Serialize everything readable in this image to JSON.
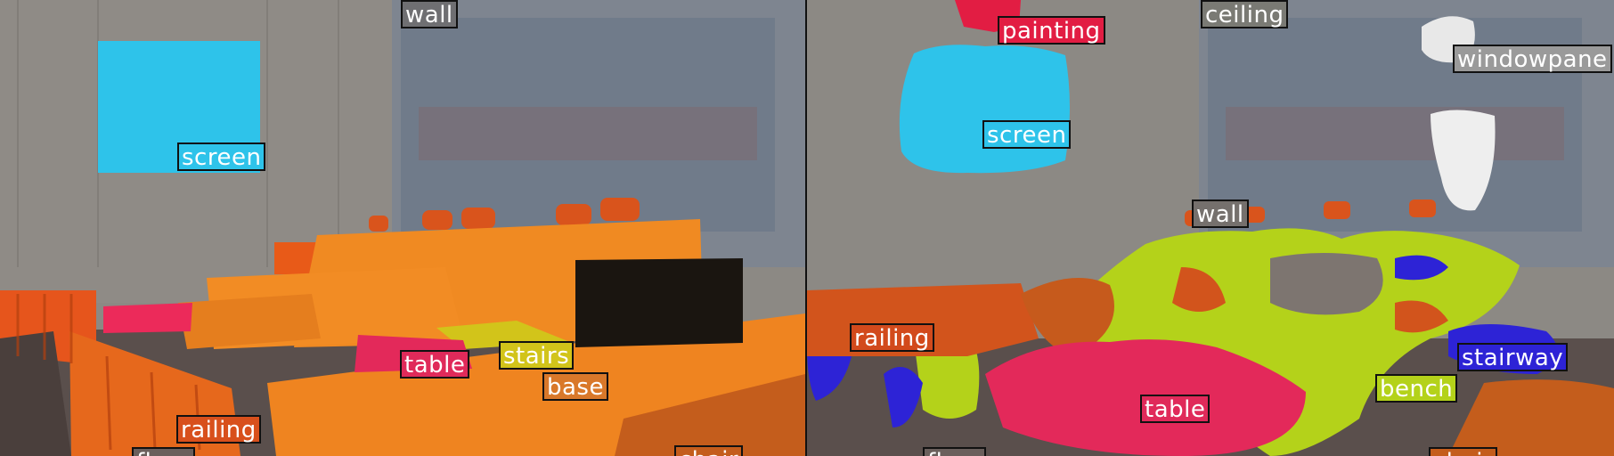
{
  "left_panel": {
    "labels": [
      {
        "text": "wall",
        "color": "#6f6f72"
      },
      {
        "text": "screen",
        "color": "#2ec3ea"
      },
      {
        "text": "table",
        "color": "#e02a5a"
      },
      {
        "text": "stairs",
        "color": "#d2c41a"
      },
      {
        "text": "base",
        "color": "#d9782a"
      },
      {
        "text": "railing",
        "color": "#d8501c"
      },
      {
        "text": "floor",
        "color": "#6a5f5c"
      },
      {
        "text": "chair",
        "color": "#c45d1c"
      }
    ]
  },
  "right_panel": {
    "labels": [
      {
        "text": "painting",
        "color": "#e21d43"
      },
      {
        "text": "ceiling",
        "color": "#7a7a74"
      },
      {
        "text": "windowpane",
        "color": "#9a9a9a"
      },
      {
        "text": "screen",
        "color": "#2ec3ea"
      },
      {
        "text": "wall",
        "color": "#75706d"
      },
      {
        "text": "railing",
        "color": "#d24a1c"
      },
      {
        "text": "stairway",
        "color": "#2d23d6"
      },
      {
        "text": "bench",
        "color": "#b4d21a"
      },
      {
        "text": "table",
        "color": "#e02a5a"
      },
      {
        "text": "floor",
        "color": "#6a5f5c"
      },
      {
        "text": "chair",
        "color": "#c45d1c"
      }
    ]
  }
}
